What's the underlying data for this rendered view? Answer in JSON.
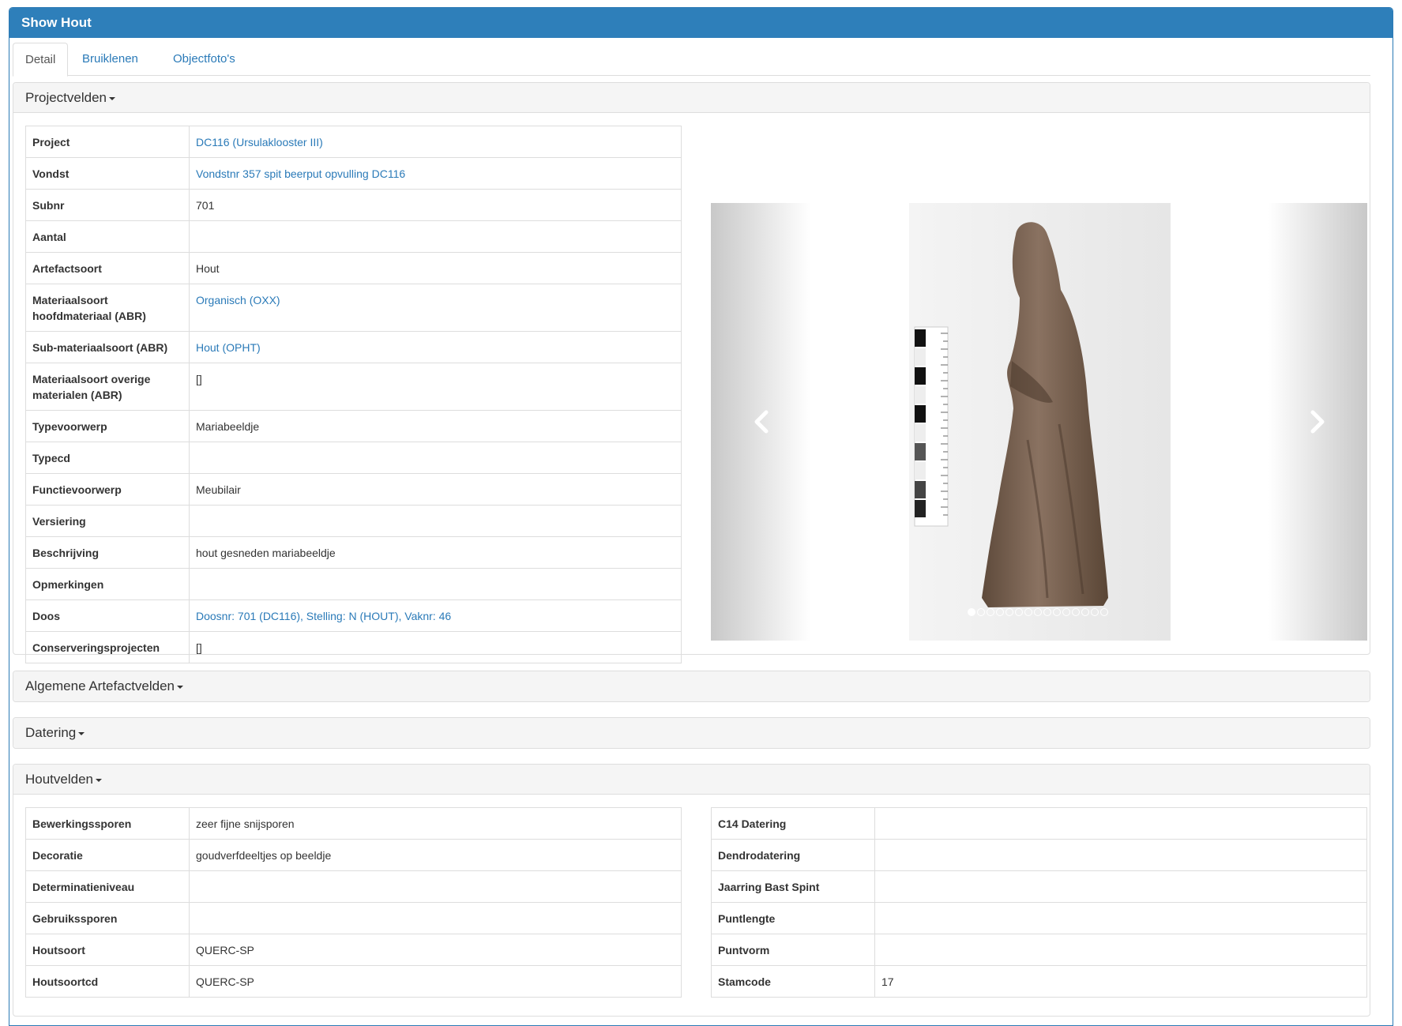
{
  "window": {
    "title": "Show Hout"
  },
  "tabs": [
    {
      "label": "Detail",
      "active": true
    },
    {
      "label": "Bruiklenen",
      "active": false
    },
    {
      "label": "Objectfoto's",
      "active": false
    }
  ],
  "sections": {
    "projectvelden": "Projectvelden",
    "algemene": "Algemene Artefactvelden",
    "datering": "Datering",
    "houtvelden": "Houtvelden"
  },
  "project_fields": [
    {
      "key": "Project",
      "value": "DC116 (Ursulaklooster III)",
      "link": true
    },
    {
      "key": "Vondst",
      "value": "Vondstnr 357 spit beerput opvulling DC116",
      "link": true
    },
    {
      "key": "Subnr",
      "value": "701",
      "link": false
    },
    {
      "key": "Aantal",
      "value": "",
      "link": false
    },
    {
      "key": "Artefactsoort",
      "value": "Hout",
      "link": false
    },
    {
      "key": "Materiaalsoort hoofdmateriaal (ABR)",
      "value": "Organisch (OXX)",
      "link": true
    },
    {
      "key": "Sub-materiaalsoort (ABR)",
      "value": "Hout (OPHT)",
      "link": true
    },
    {
      "key": "Materiaalsoort overige materialen (ABR)",
      "value": "[]",
      "link": false
    },
    {
      "key": "Typevoorwerp",
      "value": "Mariabeeldje",
      "link": false
    },
    {
      "key": "Typecd",
      "value": "",
      "link": false
    },
    {
      "key": "Functievoorwerp",
      "value": "Meubilair",
      "link": false
    },
    {
      "key": "Versiering",
      "value": "",
      "link": false
    },
    {
      "key": "Beschrijving",
      "value": "hout gesneden mariabeeldje",
      "link": false
    },
    {
      "key": "Opmerkingen",
      "value": "",
      "link": false
    },
    {
      "key": "Doos",
      "value": "Doosnr: 701 (DC116), Stelling: N (HOUT), Vaknr: 46",
      "link": true
    },
    {
      "key": "Conserveringsprojecten",
      "value": "[]",
      "link": false
    }
  ],
  "hout_left": [
    {
      "key": "Bewerkingssporen",
      "value": "zeer fijne snijsporen"
    },
    {
      "key": "Decoratie",
      "value": "goudverfdeeltjes op beeldje"
    },
    {
      "key": "Determinatieniveau",
      "value": ""
    },
    {
      "key": "Gebruikssporen",
      "value": ""
    },
    {
      "key": "Houtsoort",
      "value": "QUERC-SP"
    },
    {
      "key": "Houtsoortcd",
      "value": "QUERC-SP"
    }
  ],
  "hout_right": [
    {
      "key": "C14 Datering",
      "value": ""
    },
    {
      "key": "Dendrodatering",
      "value": ""
    },
    {
      "key": "Jaarring Bast Spint",
      "value": ""
    },
    {
      "key": "Puntlengte",
      "value": ""
    },
    {
      "key": "Puntvorm",
      "value": ""
    },
    {
      "key": "Stamcode",
      "value": "17"
    }
  ],
  "carousel": {
    "slide_count": 15,
    "active_index": 0,
    "prev_icon": "chevron-left-icon",
    "next_icon": "chevron-right-icon"
  },
  "colors": {
    "header": "#2e7fba",
    "link": "#2a7ab8",
    "border": "#dddddd",
    "section_bg": "#f5f5f5",
    "statue": "#7a6352"
  }
}
